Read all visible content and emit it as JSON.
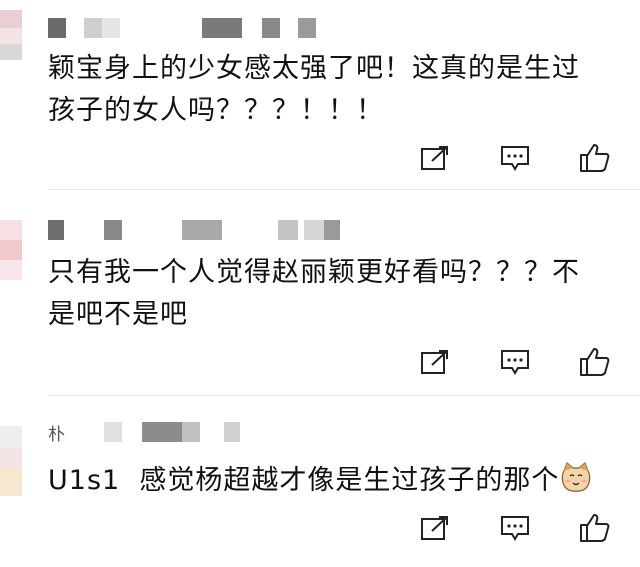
{
  "comments": [
    {
      "text": "颖宝身上的少女感太强了吧！这真的是生过\n孩子的女人吗？？？！！！",
      "actions": {
        "share_icon": "share-icon",
        "reply_icon": "comment-icon",
        "like_icon": "thumbs-up-icon"
      }
    },
    {
      "text": "只有我一个人觉得赵丽颖更好看吗？？？不\n是吧不是吧",
      "actions": {
        "share_icon": "share-icon",
        "reply_icon": "comment-icon",
        "like_icon": "thumbs-up-icon"
      }
    },
    {
      "name_glyph": "朴",
      "text": "U1s1  感觉杨超越才像是生过孩子的那个",
      "emoji": "cat-face-emoji",
      "actions": {
        "share_icon": "share-icon",
        "reply_icon": "comment-icon",
        "like_icon": "thumbs-up-icon"
      }
    }
  ],
  "colors": {
    "icon": "#222222",
    "divider": "#e4e4e4",
    "avatar_pink": "#f2c9cf",
    "blur_gray": "#bdbdbd"
  }
}
